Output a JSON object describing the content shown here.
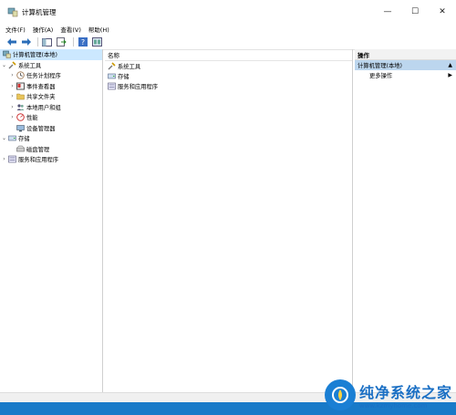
{
  "window": {
    "title": "计算机管理"
  },
  "window_controls": {
    "minimize": "—",
    "maximize": "☐",
    "close": "✕"
  },
  "menubar": [
    "文件(F)",
    "操作(A)",
    "查看(V)",
    "帮助(H)"
  ],
  "tree": {
    "root": "计算机管理(本地)",
    "system_tools": "系统工具",
    "task_scheduler": "任务计划程序",
    "event_viewer": "事件查看器",
    "shared_folders": "共享文件夹",
    "local_users": "本地用户和组",
    "performance": "性能",
    "device_manager": "设备管理器",
    "storage": "存储",
    "disk_management": "磁盘管理",
    "services": "服务和应用程序"
  },
  "center": {
    "column_name": "名称",
    "items": [
      "系统工具",
      "存储",
      "服务和应用程序"
    ]
  },
  "actions": {
    "title": "操作",
    "section": "计算机管理(本地)",
    "more": "更多操作"
  },
  "watermark": {
    "name": "纯净系统之家",
    "url": "www.kzmyhome.com"
  },
  "colors": {
    "selection": "#cce8ff",
    "action_section": "#bcd6ee",
    "desktop": "#1e88d0"
  }
}
